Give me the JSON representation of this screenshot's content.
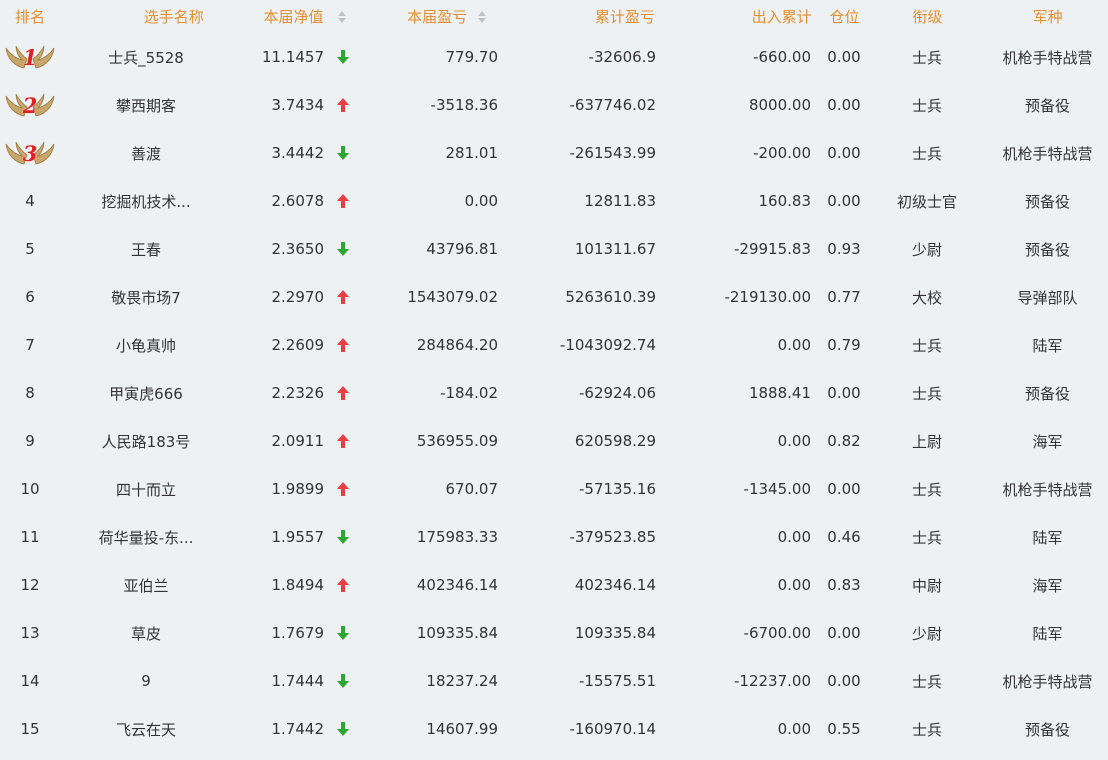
{
  "header": {
    "rank": "排名",
    "name": "选手名称",
    "nav": "本届净值",
    "pnl": "本届盈亏",
    "cum_pnl": "累计盈亏",
    "flow": "出入累计",
    "position": "仓位",
    "level": "衔级",
    "branch": "军种"
  },
  "colors": {
    "header_text": "#e4902e",
    "up": "#e64040",
    "down": "#2aa832",
    "background": "#eef1f4"
  },
  "rows": [
    {
      "rank": "1",
      "medal": true,
      "name": "士兵_5528",
      "nav": "11.1457",
      "trend": "down",
      "pnl": "779.70",
      "cum_pnl": "-32606.9",
      "flow": "-660.00",
      "position": "0.00",
      "level": "士兵",
      "branch": "机枪手特战营"
    },
    {
      "rank": "2",
      "medal": true,
      "name": "攀西期客",
      "nav": "3.7434",
      "trend": "up",
      "pnl": "-3518.36",
      "cum_pnl": "-637746.02",
      "flow": "8000.00",
      "position": "0.00",
      "level": "士兵",
      "branch": "预备役"
    },
    {
      "rank": "3",
      "medal": true,
      "name": "善渡",
      "nav": "3.4442",
      "trend": "down",
      "pnl": "281.01",
      "cum_pnl": "-261543.99",
      "flow": "-200.00",
      "position": "0.00",
      "level": "士兵",
      "branch": "机枪手特战营"
    },
    {
      "rank": "4",
      "medal": false,
      "name": "挖掘机技术...",
      "nav": "2.6078",
      "trend": "up",
      "pnl": "0.00",
      "cum_pnl": "12811.83",
      "flow": "160.83",
      "position": "0.00",
      "level": "初级士官",
      "branch": "预备役"
    },
    {
      "rank": "5",
      "medal": false,
      "name": "王春",
      "nav": "2.3650",
      "trend": "down",
      "pnl": "43796.81",
      "cum_pnl": "101311.67",
      "flow": "-29915.83",
      "position": "0.93",
      "level": "少尉",
      "branch": "预备役"
    },
    {
      "rank": "6",
      "medal": false,
      "name": "敬畏市场7",
      "nav": "2.2970",
      "trend": "up",
      "pnl": "1543079.02",
      "cum_pnl": "5263610.39",
      "flow": "-219130.00",
      "position": "0.77",
      "level": "大校",
      "branch": "导弹部队"
    },
    {
      "rank": "7",
      "medal": false,
      "name": "小龟真帅",
      "nav": "2.2609",
      "trend": "up",
      "pnl": "284864.20",
      "cum_pnl": "-1043092.74",
      "flow": "0.00",
      "position": "0.79",
      "level": "士兵",
      "branch": "陆军"
    },
    {
      "rank": "8",
      "medal": false,
      "name": "甲寅虎666",
      "nav": "2.2326",
      "trend": "up",
      "pnl": "-184.02",
      "cum_pnl": "-62924.06",
      "flow": "1888.41",
      "position": "0.00",
      "level": "士兵",
      "branch": "预备役"
    },
    {
      "rank": "9",
      "medal": false,
      "name": "人民路183号",
      "nav": "2.0911",
      "trend": "up",
      "pnl": "536955.09",
      "cum_pnl": "620598.29",
      "flow": "0.00",
      "position": "0.82",
      "level": "上尉",
      "branch": "海军"
    },
    {
      "rank": "10",
      "medal": false,
      "name": "四十而立",
      "nav": "1.9899",
      "trend": "up",
      "pnl": "670.07",
      "cum_pnl": "-57135.16",
      "flow": "-1345.00",
      "position": "0.00",
      "level": "士兵",
      "branch": "机枪手特战营"
    },
    {
      "rank": "11",
      "medal": false,
      "name": "荷华量投-东...",
      "nav": "1.9557",
      "trend": "down",
      "pnl": "175983.33",
      "cum_pnl": "-379523.85",
      "flow": "0.00",
      "position": "0.46",
      "level": "士兵",
      "branch": "陆军"
    },
    {
      "rank": "12",
      "medal": false,
      "name": "亚伯兰",
      "nav": "1.8494",
      "trend": "up",
      "pnl": "402346.14",
      "cum_pnl": "402346.14",
      "flow": "0.00",
      "position": "0.83",
      "level": "中尉",
      "branch": "海军"
    },
    {
      "rank": "13",
      "medal": false,
      "name": "草皮",
      "nav": "1.7679",
      "trend": "down",
      "pnl": "109335.84",
      "cum_pnl": "109335.84",
      "flow": "-6700.00",
      "position": "0.00",
      "level": "少尉",
      "branch": "陆军"
    },
    {
      "rank": "14",
      "medal": false,
      "name": "9",
      "nav": "1.7444",
      "trend": "down",
      "pnl": "18237.24",
      "cum_pnl": "-15575.51",
      "flow": "-12237.00",
      "position": "0.00",
      "level": "士兵",
      "branch": "机枪手特战营"
    },
    {
      "rank": "15",
      "medal": false,
      "name": "飞云在天",
      "nav": "1.7442",
      "trend": "down",
      "pnl": "14607.99",
      "cum_pnl": "-160970.14",
      "flow": "0.00",
      "position": "0.55",
      "level": "士兵",
      "branch": "预备役"
    }
  ]
}
